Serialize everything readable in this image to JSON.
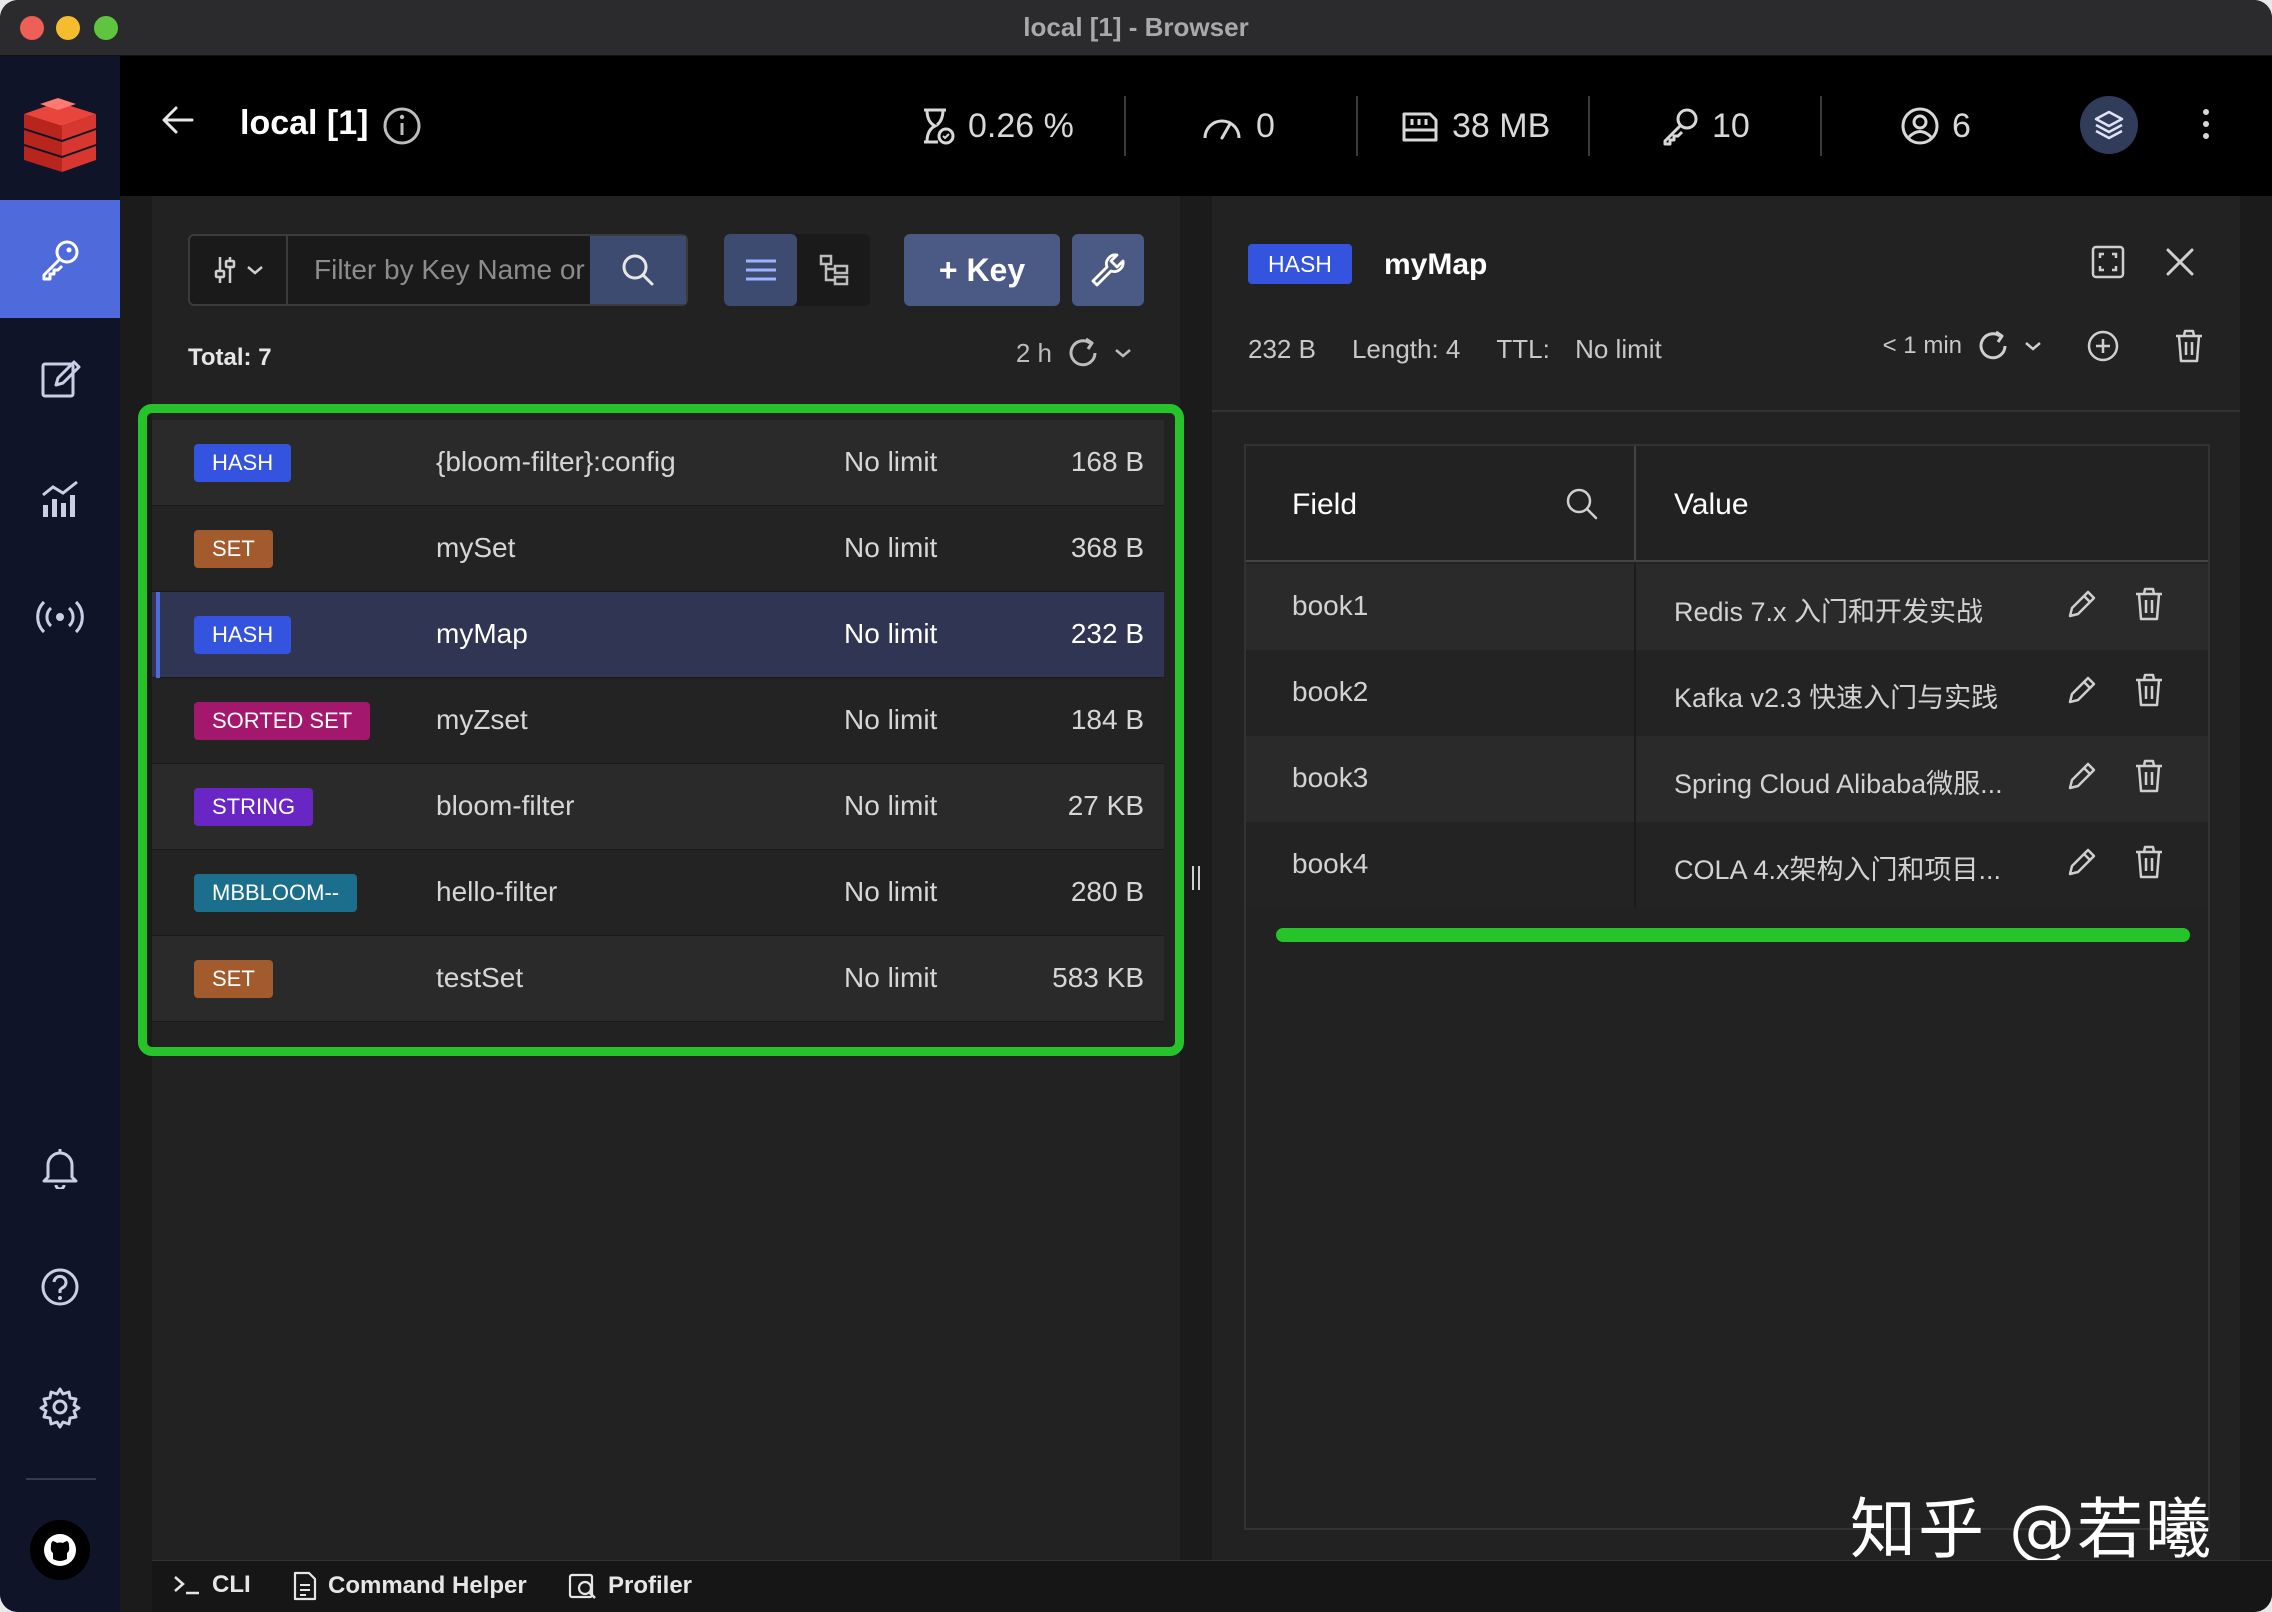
{
  "window": {
    "title": "local [1] - Browser"
  },
  "header": {
    "db_name": "local [1]",
    "stats": {
      "cpu": "0.26 %",
      "ops": "0",
      "memory": "38 MB",
      "keys": "10",
      "clients": "6"
    }
  },
  "key_list": {
    "filter_placeholder": "Filter by Key Name or Pattern",
    "add_key_label": "+ Key",
    "total_label": "Total: 7",
    "refresh_ago": "2 h",
    "rows": [
      {
        "type": "HASH",
        "type_color": "#3454e0",
        "name": "{bloom-filter}:config",
        "ttl": "No limit",
        "size": "168 B"
      },
      {
        "type": "SET",
        "type_color": "#a35a2c",
        "name": "mySet",
        "ttl": "No limit",
        "size": "368 B"
      },
      {
        "type": "HASH",
        "type_color": "#3454e0",
        "name": "myMap",
        "ttl": "No limit",
        "size": "232 B"
      },
      {
        "type": "SORTED SET",
        "type_color": "#a3176d",
        "name": "myZset",
        "ttl": "No limit",
        "size": "184 B"
      },
      {
        "type": "STRING",
        "type_color": "#6a26c4",
        "name": "bloom-filter",
        "ttl": "No limit",
        "size": "27 KB"
      },
      {
        "type": "MBBLOOM--",
        "type_color": "#1c6f8c",
        "name": "hello-filter",
        "ttl": "No limit",
        "size": "280 B"
      },
      {
        "type": "SET",
        "type_color": "#a35a2c",
        "name": "testSet",
        "ttl": "No limit",
        "size": "583 KB"
      }
    ]
  },
  "details": {
    "type": "HASH",
    "key_name": "myMap",
    "size": "232 B",
    "length_label": "Length: 4",
    "ttl_label": "TTL:",
    "ttl_value": "No limit",
    "refreshed": "< 1 min",
    "columns": {
      "field": "Field",
      "value": "Value"
    },
    "rows": [
      {
        "field": "book1",
        "value": "Redis 7.x 入门和开发实战"
      },
      {
        "field": "book2",
        "value": "Kafka v2.3 快速入门与实践"
      },
      {
        "field": "book3",
        "value": "Spring Cloud Alibaba微服..."
      },
      {
        "field": "book4",
        "value": "COLA 4.x架构入门和项目..."
      }
    ]
  },
  "bottombar": {
    "cli": "CLI",
    "command_helper": "Command Helper",
    "profiler": "Profiler"
  },
  "watermark": "知乎 @若曦"
}
